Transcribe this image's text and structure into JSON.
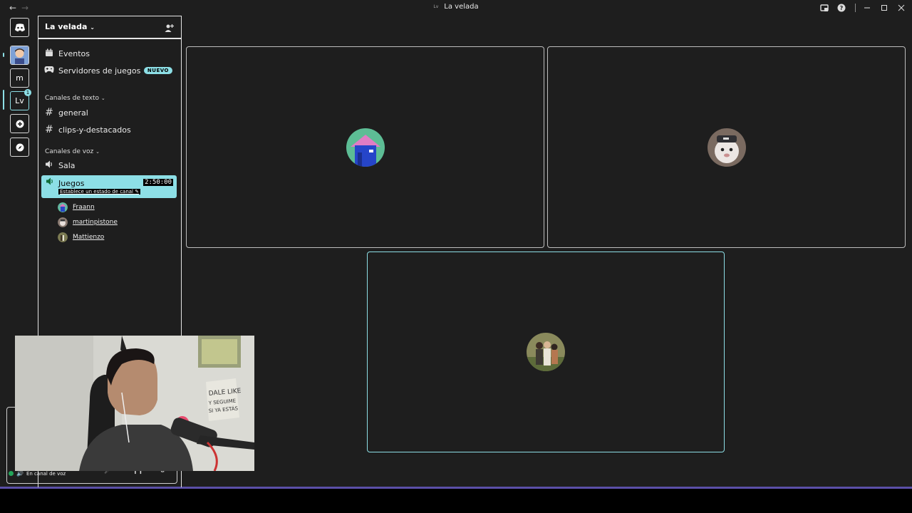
{
  "window": {
    "title": "La velada",
    "title_icon": "Lv",
    "back_icon": "arrow-left-icon",
    "forward_icon": "arrow-right-icon"
  },
  "rail": {
    "servers": [
      {
        "label": "",
        "icon": "discord-logo-icon"
      },
      {
        "label": "",
        "icon": "avatar"
      },
      {
        "label": "m"
      },
      {
        "label": "Lv",
        "active": true,
        "badge": "1"
      },
      {
        "label": "",
        "icon": "plus-icon"
      },
      {
        "label": "",
        "icon": "compass-icon"
      }
    ]
  },
  "guild": {
    "name": "La velada",
    "items": [
      {
        "label": "Eventos",
        "icon": "calendar-icon"
      },
      {
        "label": "Servidores de juegos",
        "icon": "gamepad-icon",
        "badge": "NUEVO"
      }
    ],
    "text_category": "Canales de texto",
    "text_channels": [
      "general",
      "clips-y-destacados"
    ],
    "voice_category": "Canales de voz",
    "voice_channels": [
      {
        "name": "Sala"
      },
      {
        "name": "Juegos",
        "timer": "2:50:00",
        "status": "Establece un estado de canal",
        "active": true
      }
    ],
    "members": [
      "Fraann",
      "martinpistone",
      "Mattienzo"
    ]
  },
  "user_panel": {
    "status": "En canal de voz"
  },
  "colors": {
    "accent": "#8ddfe6",
    "background": "#1e1e1e",
    "border": "#bdbdbd",
    "bottom_bar": "#5b4fa8"
  }
}
